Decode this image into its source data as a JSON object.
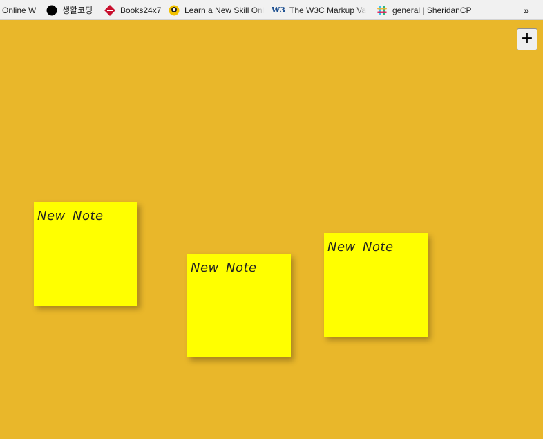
{
  "bookmarks": [
    {
      "label": "Online W",
      "icon": "none"
    },
    {
      "label": "생활코딩",
      "icon": "black-circle-icon"
    },
    {
      "label": "Books24x7",
      "icon": "books24x7-icon"
    },
    {
      "label": "Learn a New Skill Onl",
      "icon": "lynda-icon"
    },
    {
      "label": "The W3C Markup Val",
      "icon": "w3c-icon",
      "icon_text": "W3"
    },
    {
      "label": "general | SheridanCP",
      "icon": "slack-icon"
    }
  ],
  "overflow_label": "»",
  "add_button_label": "+",
  "notes": [
    {
      "text": "New Note"
    },
    {
      "text": "New Note"
    },
    {
      "text": "New Note"
    }
  ],
  "colors": {
    "background": "#e9b72a",
    "note": "#ffff00"
  }
}
